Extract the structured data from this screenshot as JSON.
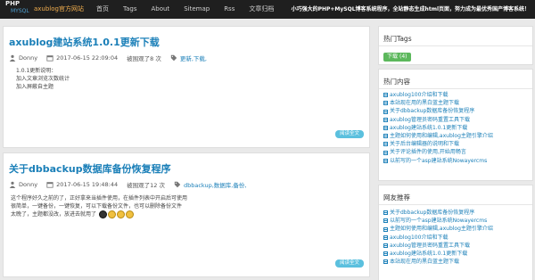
{
  "nav": {
    "logo_top": "PHP",
    "logo_bottom": "MYSQL",
    "brand": "axublog官方网站",
    "items": [
      "首页",
      "Tags",
      "About",
      "Sitemap",
      "Rss",
      "文章归档"
    ],
    "tagline": "小巧强大的PHP+MySQL博客系统程序，全站静态生成html页面，努力成为最优秀国产博客系统！"
  },
  "posts": [
    {
      "title": "axublog建站系统1.0.1更新下载",
      "author": "Donny",
      "date": "2017-06-15 22:09:04",
      "views": "被围观了8 次",
      "tags": "更新,下载,",
      "excerpt": [
        "1.0.1更新说明：",
        "加入文章浏览次数统计",
        "加入屏蔽自主题"
      ],
      "read_more": "阅读全文"
    },
    {
      "title": "关于dbbackup数据库备份恢复程序",
      "author": "Donny",
      "date": "2017-06-15 19:48:44",
      "views": "被围观了12 次",
      "tags": "dbbackup,数据库,备份,",
      "excerpt": [
        "这个程序好久之前的了，正好拿来当插件使用，在插件列表中开启后可使用",
        "很简单，一键备份，一键恢复，可以下载备份文件，也可以删除备份文件",
        "太晚了，主题都没改，放进去就用了"
      ],
      "read_more": "阅读全文"
    }
  ],
  "sidebar": {
    "tags_title": "热门Tags",
    "tag": {
      "label": "下载",
      "count": "(4)"
    },
    "hot_title": "热门内容",
    "hot": [
      "axublog100介绍和下载",
      "本站现在用的黑白蓝主题下载",
      "关于dbbackup数据库备份恢复程序",
      "axublog管理员密码重置工具下载",
      "axublog建站系统1.0.1更新下载",
      "主题如何使用和编辑,axublog主题引擎介绍",
      "关于后台编辑器的说明和下载",
      "关于评论插件的使用,开始用畅言",
      "以前写的一个asp建站系统Nowayercms"
    ],
    "links_title": "网友推荐",
    "links": [
      "关于dbbackup数据库备份恢复程序",
      "以前写的一个asp建站系统Nowayercms",
      "主题如何使用和编辑,axublog主题引擎介绍",
      "axublog100介绍和下载",
      "axublog管理员密码重置工具下载",
      "axublog建站系统1.0.1更新下载",
      "本站现在用的黑白蓝主题下载"
    ]
  }
}
